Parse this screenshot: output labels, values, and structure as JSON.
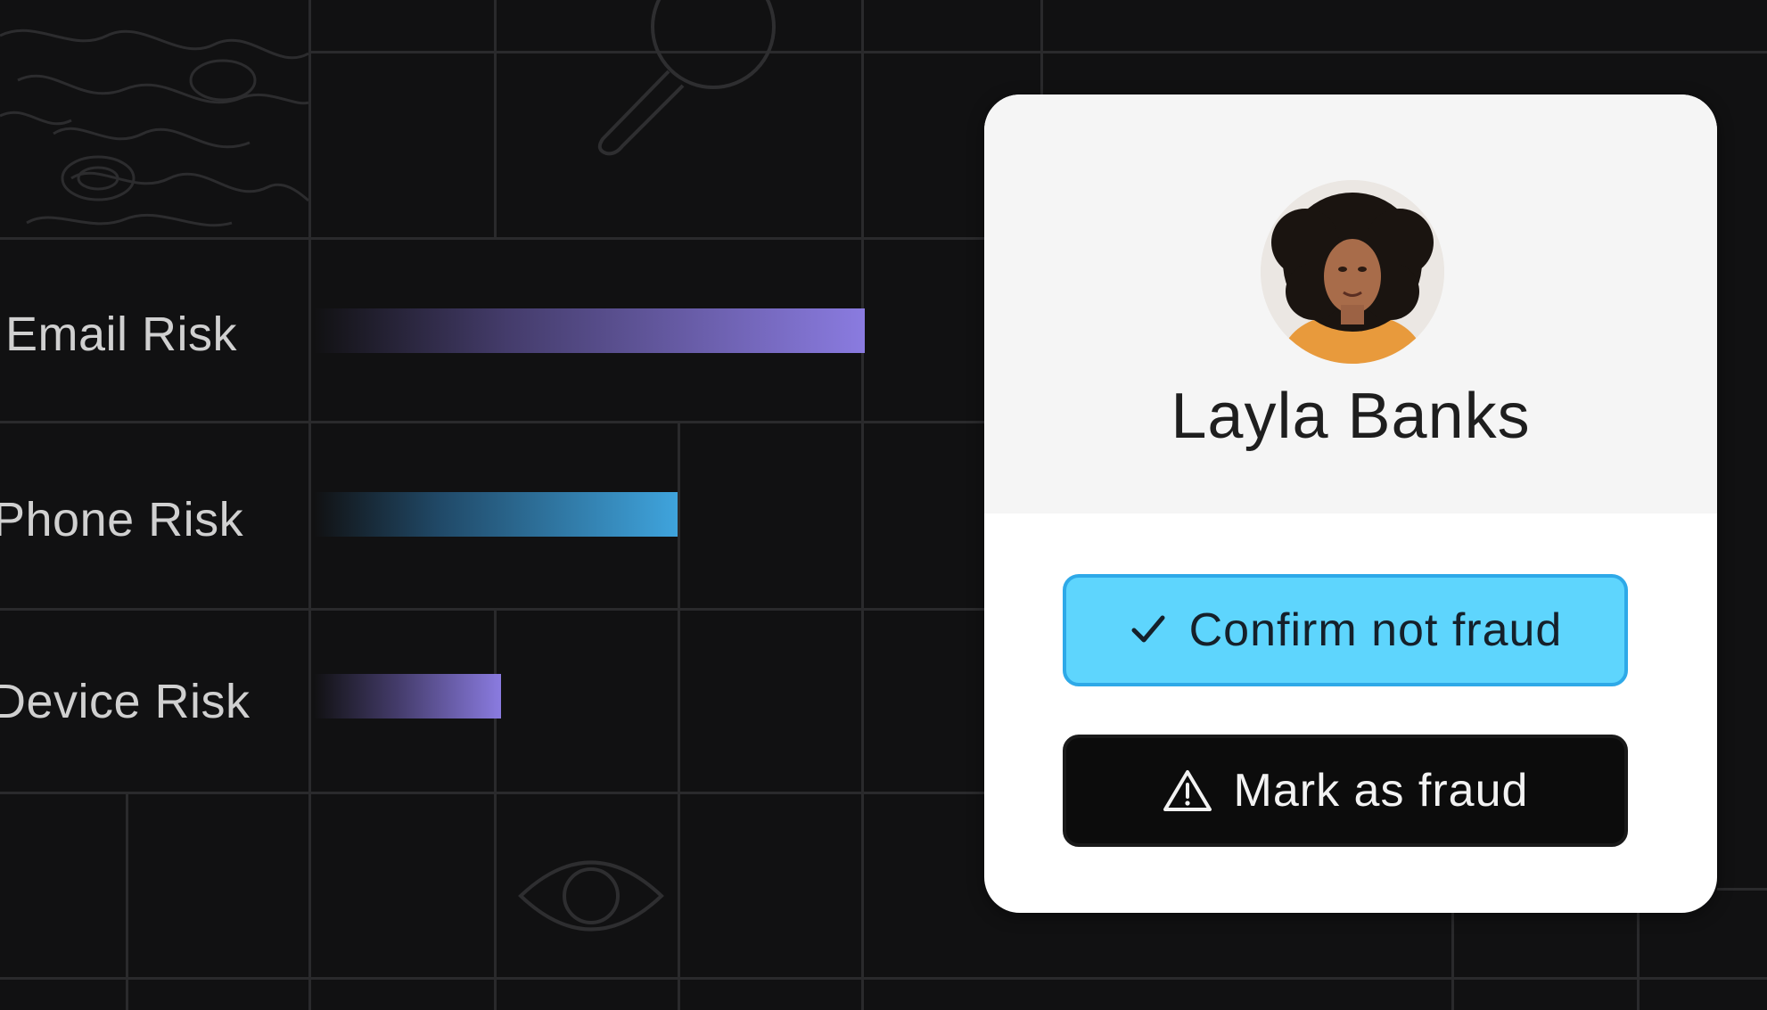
{
  "risk_rows": [
    {
      "label": "Email Risk",
      "level": 1.0,
      "color": "#8a7be0"
    },
    {
      "label": "Phone Risk",
      "level": 0.66,
      "color": "#3fa4dd"
    },
    {
      "label": "Device Risk",
      "level": 0.34,
      "color": "#8a7be0"
    }
  ],
  "profile": {
    "name": "Layla Banks"
  },
  "actions": {
    "confirm_label": "Confirm not fraud",
    "confirm_icon": "check-icon",
    "confirm_color": "#5ed5fd",
    "fraud_label": "Mark as fraud",
    "fraud_icon": "warning-icon",
    "fraud_color": "#0c0c0c"
  },
  "decorations": [
    "topographic-pattern-icon",
    "magnifier-icon",
    "eye-icon"
  ]
}
